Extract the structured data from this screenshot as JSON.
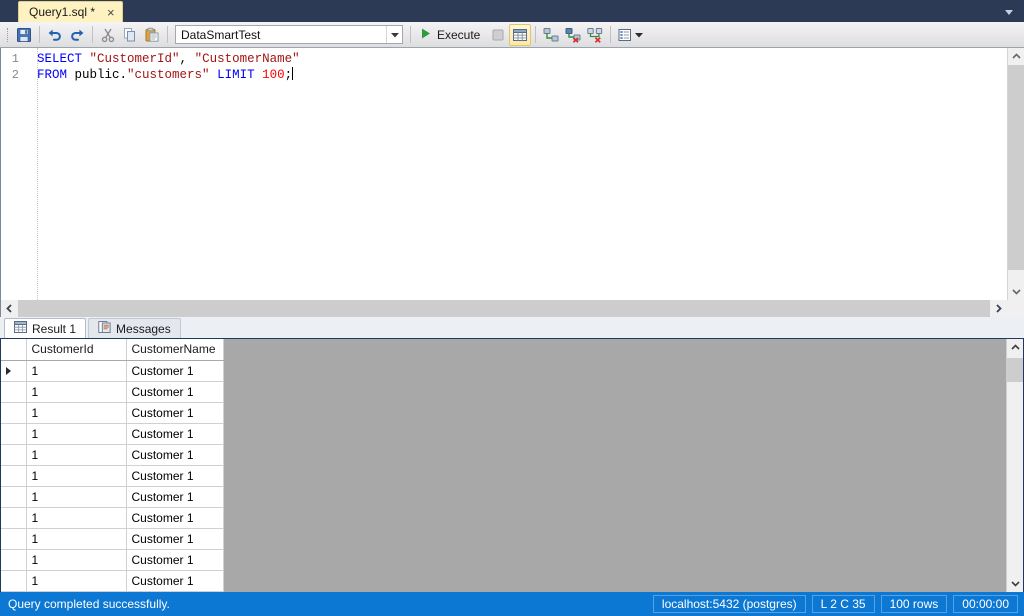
{
  "tabstrip": {
    "document_tab": {
      "label": "Query1.sql *",
      "close_glyph": "×"
    },
    "overflow_icon": "chevron-down-icon"
  },
  "toolbar": {
    "save_label": "save-icon",
    "undo_label": "undo-icon",
    "redo_label": "redo-icon",
    "cut_label": "cut-icon",
    "copy_label": "copy-icon",
    "paste_label": "paste-icon",
    "connection": {
      "value": "DataSmartTest",
      "placeholder": "Select connection"
    },
    "execute_label": "Execute",
    "stop_label": "stop-icon",
    "results_to_grid_label": "results-to-grid-icon",
    "connect_label": "connect-icon",
    "disconnect_label": "disconnect-icon",
    "change_connection_label": "change-connection-icon",
    "query_options_label": "query-options-icon"
  },
  "editor": {
    "line_numbers": [
      "1",
      "2"
    ],
    "lines": [
      [
        {
          "t": "SELECT",
          "k": "kw"
        },
        {
          "t": " ",
          "k": "pln"
        },
        {
          "t": "\"CustomerId\"",
          "k": "str"
        },
        {
          "t": ", ",
          "k": "pln"
        },
        {
          "t": "\"CustomerName\"",
          "k": "str"
        }
      ],
      [
        {
          "t": "FROM",
          "k": "kw"
        },
        {
          "t": " public.",
          "k": "pln"
        },
        {
          "t": "\"customers\"",
          "k": "str"
        },
        {
          "t": " ",
          "k": "pln"
        },
        {
          "t": "LIMIT",
          "k": "kw"
        },
        {
          "t": " ",
          "k": "pln"
        },
        {
          "t": "100",
          "k": "num"
        },
        {
          "t": ";",
          "k": "pln"
        }
      ]
    ]
  },
  "result_tabs": [
    {
      "label": "Result 1",
      "icon": "grid-icon",
      "selected": true
    },
    {
      "label": "Messages",
      "icon": "messages-icon",
      "selected": false
    }
  ],
  "grid": {
    "columns": [
      "CustomerId",
      "CustomerName"
    ],
    "rows": [
      {
        "CustomerId": "1",
        "CustomerName": "Customer 1",
        "current": true
      },
      {
        "CustomerId": "1",
        "CustomerName": "Customer 1",
        "current": false
      },
      {
        "CustomerId": "1",
        "CustomerName": "Customer 1",
        "current": false
      },
      {
        "CustomerId": "1",
        "CustomerName": "Customer 1",
        "current": false
      },
      {
        "CustomerId": "1",
        "CustomerName": "Customer 1",
        "current": false
      },
      {
        "CustomerId": "1",
        "CustomerName": "Customer 1",
        "current": false
      },
      {
        "CustomerId": "1",
        "CustomerName": "Customer 1",
        "current": false
      },
      {
        "CustomerId": "1",
        "CustomerName": "Customer 1",
        "current": false
      },
      {
        "CustomerId": "1",
        "CustomerName": "Customer 1",
        "current": false
      },
      {
        "CustomerId": "1",
        "CustomerName": "Customer 1",
        "current": false
      },
      {
        "CustomerId": "1",
        "CustomerName": "Customer 1",
        "current": false
      }
    ]
  },
  "statusbar": {
    "message": "Query completed successfully.",
    "server": "localhost:5432 (postgres)",
    "caret": "L 2 C 35",
    "rows": "100 rows",
    "elapsed": "00:00:00"
  },
  "colors": {
    "accent": "#0c78d4",
    "tab_active": "#fdf2c0",
    "chrome": "#2c3a56",
    "selection": "#2196f3",
    "grid_empty": "#a8a8a8"
  }
}
